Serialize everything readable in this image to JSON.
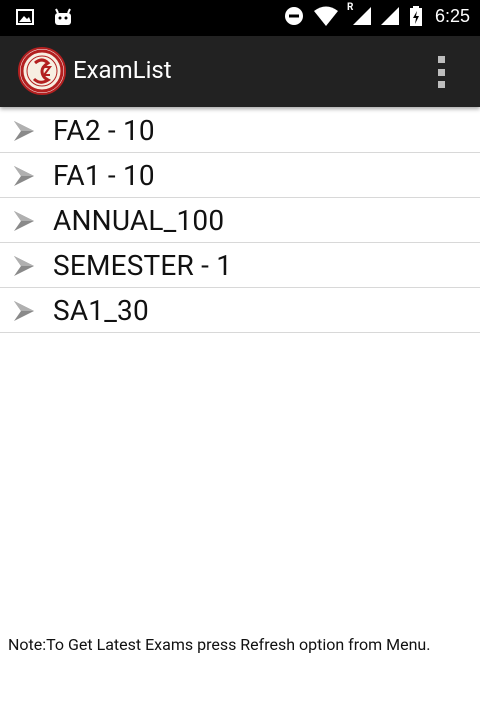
{
  "status_bar": {
    "time": "6:25",
    "roaming_indicator": "R",
    "icons": [
      "gallery-icon",
      "android-icon",
      "do-not-disturb-icon",
      "wifi-icon",
      "signal-icon",
      "signal-icon",
      "battery-charging-icon"
    ]
  },
  "app_bar": {
    "title": "ExamList",
    "logo_icon": "school-logo",
    "menu_icon": "overflow-menu-icon"
  },
  "exams": [
    {
      "label": "FA2 - 10"
    },
    {
      "label": "FA1 - 10"
    },
    {
      "label": "ANNUAL_100"
    },
    {
      "label": "SEMESTER - 1"
    },
    {
      "label": "SA1_30"
    }
  ],
  "note": "Note:To Get Latest Exams press Refresh option from Menu.",
  "colors": {
    "app_bar": "#222222",
    "status_bar": "#000000",
    "divider": "#d8d8d8",
    "chevron": "#8a8a8a"
  }
}
